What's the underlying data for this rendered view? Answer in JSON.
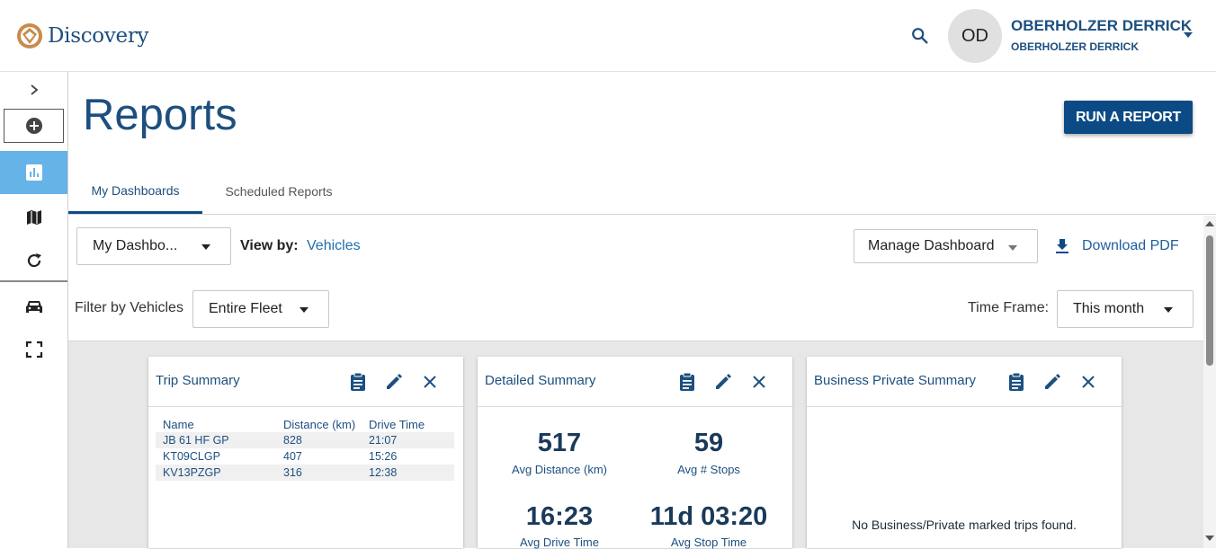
{
  "brand": {
    "name": "Discovery",
    "color": "#1d4f7f",
    "accent": "#0b4a85",
    "highlight": "#66b3e8"
  },
  "header": {
    "avatar_initials": "OD",
    "user_name": "OBERHOLZER DERRICK",
    "user_sub": "OBERHOLZER DERRICK"
  },
  "sidebar": {
    "items": [
      "chevron-right-icon",
      "add-circle-icon",
      "bar-chart-icon",
      "map-icon",
      "refresh-icon",
      "car-icon",
      "fullscreen-icon"
    ]
  },
  "page": {
    "title": "Reports",
    "run_report_label": "RUN A REPORT"
  },
  "tabs": [
    {
      "label": "My Dashboards",
      "active": true
    },
    {
      "label": "Scheduled Reports",
      "active": false
    }
  ],
  "controls": {
    "dashboard_select": "My Dashbo...",
    "view_by_label": "View by:",
    "view_by_value": "Vehicles",
    "manage_dashboard": "Manage Dashboard",
    "download_pdf": "Download PDF",
    "filter_label": "Filter by Vehicles",
    "filter_value": "Entire Fleet",
    "timeframe_label": "Time Frame:",
    "timeframe_value": "This month"
  },
  "cards": {
    "trip_summary": {
      "title": "Trip Summary",
      "columns": [
        "Name",
        "Distance (km)",
        "Drive Time"
      ],
      "rows": [
        [
          "JB 61 HF GP",
          "828",
          "21:07"
        ],
        [
          "KT09CLGP",
          "407",
          "15:26"
        ],
        [
          "KV13PZGP",
          "316",
          "12:38"
        ]
      ]
    },
    "detailed_summary": {
      "title": "Detailed Summary",
      "stats": [
        {
          "value": "517",
          "label": "Avg Distance (km)"
        },
        {
          "value": "59",
          "label": "Avg # Stops"
        },
        {
          "value": "16:23",
          "label": "Avg Drive Time"
        },
        {
          "value": "11d 03:20",
          "label": "Avg Stop Time"
        }
      ]
    },
    "business_private": {
      "title": "Business Private Summary",
      "empty_message": "No Business/Private marked trips found."
    }
  }
}
